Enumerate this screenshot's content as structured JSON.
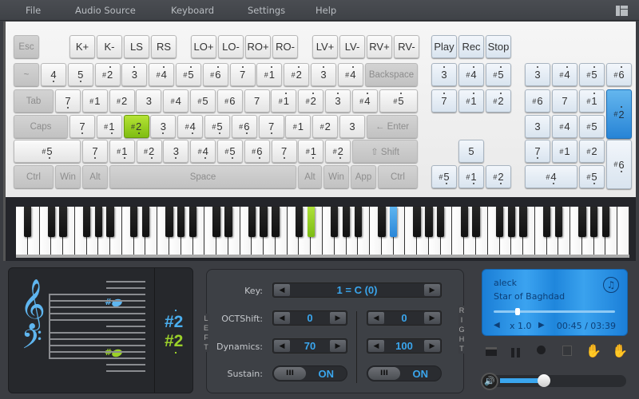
{
  "menu": {
    "items": [
      "File",
      "Audio Source",
      "Keyboard",
      "Settings",
      "Help"
    ],
    "layout_icon": "layout-icon"
  },
  "colors": {
    "accent_blue": "#3aa6ee",
    "accent_green": "#8fcc1e",
    "panel_dark": "#26282c"
  },
  "keyboard": {
    "rows": [
      [
        {
          "t": "Esc",
          "fn": true
        },
        {
          "t": "K+"
        },
        {
          "t": "K-"
        },
        {
          "t": "LS"
        },
        {
          "t": "RS"
        },
        {
          "t": "LO+"
        },
        {
          "t": "LO-"
        },
        {
          "t": "RO+"
        },
        {
          "t": "RO-"
        },
        {
          "t": "LV+"
        },
        {
          "t": "LV-"
        },
        {
          "t": "RV+"
        },
        {
          "t": "RV-"
        },
        {
          "t": "Play",
          "blue": true
        },
        {
          "t": "Rec",
          "blue": true
        },
        {
          "t": "Stop",
          "blue": true
        }
      ],
      [
        {
          "t": "~",
          "fn": true
        },
        {
          "t": "4",
          "d": "dn"
        },
        {
          "t": "5",
          "d": "dn"
        },
        {
          "t": "#2",
          "d": "up"
        },
        {
          "t": "3",
          "d": "up"
        },
        {
          "t": "#4",
          "d": "up"
        },
        {
          "t": "#5",
          "d": "up"
        },
        {
          "t": "#6",
          "d": "up"
        },
        {
          "t": "7",
          "d": "up"
        },
        {
          "t": "#1",
          "d": "up"
        },
        {
          "t": "#2",
          "d": "up"
        },
        {
          "t": "3",
          "d": "up"
        },
        {
          "t": "#4",
          "d": "up"
        },
        {
          "t": "Backspace",
          "fn": true
        }
      ],
      [
        {
          "t": "Tab",
          "fn": true
        },
        {
          "t": "7",
          "d": "dn"
        },
        {
          "t": "#1"
        },
        {
          "t": "#2"
        },
        {
          "t": "3"
        },
        {
          "t": "#4"
        },
        {
          "t": "#5"
        },
        {
          "t": "#6"
        },
        {
          "t": "7"
        },
        {
          "t": "#1",
          "d": "up"
        },
        {
          "t": "#2",
          "d": "up"
        },
        {
          "t": "3",
          "d": "up"
        },
        {
          "t": "#4",
          "d": "up"
        },
        {
          "t": "#5",
          "d": "up"
        }
      ],
      [
        {
          "t": "Caps",
          "fn": true
        },
        {
          "t": "7",
          "d": "dn"
        },
        {
          "t": "#1",
          "d": "dn"
        },
        {
          "t": "#2",
          "d": "dn",
          "active": "green"
        },
        {
          "t": "3",
          "d": "dn"
        },
        {
          "t": "#4",
          "d": "dn"
        },
        {
          "t": "#5",
          "d": "dn"
        },
        {
          "t": "#6",
          "d": "dn"
        },
        {
          "t": "7",
          "d": "dn"
        },
        {
          "t": "#1"
        },
        {
          "t": "#2"
        },
        {
          "t": "3"
        },
        {
          "t": "← Enter",
          "fn": true
        }
      ],
      [
        {
          "t": "#5",
          "d": "dn"
        },
        {
          "t": "7",
          "d": "dn"
        },
        {
          "t": "#1",
          "d": "dn"
        },
        {
          "t": "#2",
          "d": "dn"
        },
        {
          "t": "3",
          "d": "dn"
        },
        {
          "t": "#4",
          "d": "dn"
        },
        {
          "t": "#5",
          "d": "dn"
        },
        {
          "t": "#6",
          "d": "dn"
        },
        {
          "t": "7",
          "d": "dn"
        },
        {
          "t": "#1",
          "d": "dn"
        },
        {
          "t": "#2",
          "d": "dn"
        },
        {
          "t": "⇧ Shift",
          "fn": true
        }
      ],
      [
        {
          "t": "Ctrl",
          "fn": true
        },
        {
          "t": "Win",
          "fn": true
        },
        {
          "t": "Alt",
          "fn": true
        },
        {
          "t": "Space",
          "fn": true
        },
        {
          "t": "Alt",
          "fn": true
        },
        {
          "t": "Win",
          "fn": true
        },
        {
          "t": "App",
          "fn": true
        },
        {
          "t": "Ctrl",
          "fn": true
        }
      ]
    ],
    "nav": [
      {
        "t": "3",
        "d": "up"
      },
      {
        "t": "#4",
        "d": "up"
      },
      {
        "t": "#5",
        "d": "up"
      },
      {
        "t": "7",
        "d": "up"
      },
      {
        "t": "#1",
        "d": "up"
      },
      {
        "t": "#2",
        "d": "up"
      },
      {
        "t": "5"
      },
      {
        "t": "#5",
        "d": "dn"
      },
      {
        "t": "#1",
        "d": "dn"
      },
      {
        "t": "#2",
        "d": "dn"
      }
    ],
    "numpad": [
      {
        "t": "3",
        "d": "up"
      },
      {
        "t": "#4",
        "d": "up"
      },
      {
        "t": "#5",
        "d": "up"
      },
      {
        "t": "#6",
        "d": "up"
      },
      {
        "t": "#6"
      },
      {
        "t": "7"
      },
      {
        "t": "#1",
        "d": "up"
      },
      {
        "t": "#2",
        "d": "up",
        "active": "blue"
      },
      {
        "t": "3"
      },
      {
        "t": "#4"
      },
      {
        "t": "#5"
      },
      {
        "t": "7",
        "d": "dn"
      },
      {
        "t": "#1"
      },
      {
        "t": "#2"
      },
      {
        "t": "#6",
        "d": "dn"
      },
      {
        "t": "#4",
        "d": "dn"
      },
      {
        "t": "#5",
        "d": "dn"
      }
    ]
  },
  "piano": {
    "white_keys": 52,
    "first_note": "A0",
    "last_note": "C8",
    "active_left_key": "D#4",
    "active_right_key": "D#5"
  },
  "notation": {
    "left_note": "#2",
    "right_note": "#2",
    "treble_clef": "𝄞",
    "bass_clef": "𝄢"
  },
  "controls": {
    "key_label": "Key:",
    "key_value": "1 = C (0)",
    "octshift_label": "OCTShift:",
    "left_octshift": "0",
    "right_octshift": "0",
    "dynamics_label": "Dynamics:",
    "left_dynamics": "70",
    "right_dynamics": "100",
    "sustain_label": "Sustain:",
    "left_sustain": "ON",
    "right_sustain": "ON",
    "knob_text": "III",
    "left_side": "LEFT",
    "right_side": "RIGHT",
    "arrow_left": "◀",
    "arrow_right": "▶"
  },
  "player": {
    "artist": "aleck",
    "title": "Star of Baghdad",
    "speed": "x 1.0",
    "time": "00:45 / 03:39",
    "progress": 0.2,
    "volume": 0.35
  }
}
